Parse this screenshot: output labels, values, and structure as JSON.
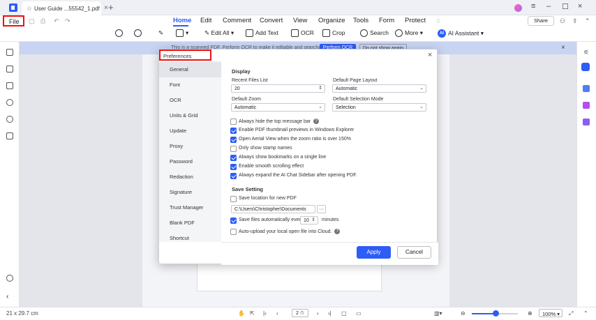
{
  "tab": {
    "title": "User Guide ...55542_1.pdf"
  },
  "menu": {
    "file": "File",
    "share": "Share"
  },
  "nav_tabs": [
    "Home",
    "Edit",
    "Comment",
    "Convert",
    "View",
    "Organize",
    "Tools",
    "Form",
    "Protect"
  ],
  "toolbar": {
    "edit_all": "Edit All",
    "add_text": "Add Text",
    "ocr": "OCR",
    "crop": "Crop",
    "search": "Search",
    "more": "More",
    "ai_assistant": "AI Assistant",
    "ai_badge": "AI"
  },
  "banner": {
    "text": "This is a scanned PDF. Perform OCR to make it editable and searchable.",
    "perform_ocr": "Perform OCR",
    "dont_show": "Do not show again"
  },
  "dialog": {
    "title": "Preferences",
    "nav": [
      "General",
      "Font",
      "OCR",
      "Units & Grid",
      "Update",
      "Proxy",
      "Password",
      "Redaction",
      "Signature",
      "Trust Manager",
      "Blank PDF",
      "Shortcut"
    ],
    "display_heading": "Display",
    "recent_files_label": "Recent Files List",
    "recent_files_value": "20",
    "default_layout_label": "Default Page Layout",
    "default_layout_value": "Automatic",
    "default_zoom_label": "Default Zoom",
    "default_zoom_value": "Automatic",
    "selection_mode_label": "Default Selection Mode",
    "selection_mode_value": "Selection",
    "options": [
      {
        "label": "Always hide the top message bar",
        "checked": false
      },
      {
        "label": "Enable PDF thumbnail previews in Windows Explorer",
        "checked": true
      },
      {
        "label": "Open Aerial View when the zoom ratio is over 150%",
        "checked": true
      },
      {
        "label": "Only show stamp names",
        "checked": false
      },
      {
        "label": "Always show bookmarks on a single line",
        "checked": true
      },
      {
        "label": "Enable smooth scrolling effect",
        "checked": true
      },
      {
        "label": "Always expand the AI Chat Sidebar after opening PDF.",
        "checked": true
      }
    ],
    "save_heading": "Save Setting",
    "save_location_label": "Save location for new PDF",
    "save_location_path": "C:\\Users\\Christopher\\Documents",
    "browse": "···",
    "autosave_label": "Save files automatically every",
    "autosave_value": "10",
    "autosave_unit": "minutes",
    "autoupload_label": "Auto-upload your local open file into Cloud.",
    "apply": "Apply",
    "cancel": "Cancel"
  },
  "status": {
    "page_size": "21 x 29.7 cm",
    "current_page": "2",
    "page_total": "/5",
    "zoom": "100%"
  }
}
